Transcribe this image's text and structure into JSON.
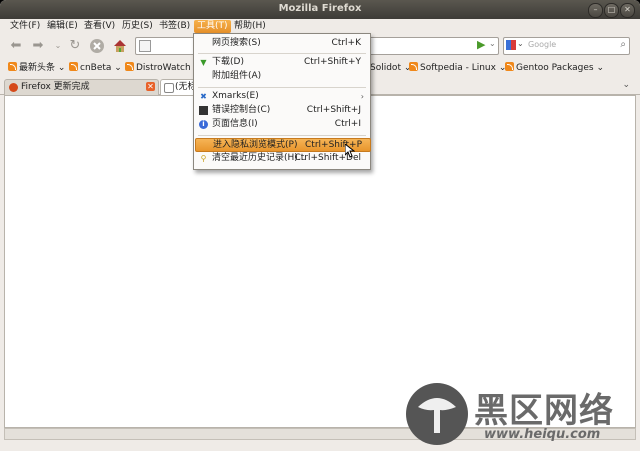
{
  "window": {
    "title": "Mozilla Firefox",
    "controls": [
      "–",
      "□",
      "✕"
    ]
  },
  "menubar": {
    "items": [
      "文件(F)",
      "编辑(E)",
      "查看(V)",
      "历史(S)",
      "书签(B)",
      "工具(T)",
      "帮助(H)"
    ],
    "open_index": 5
  },
  "search": {
    "placeholder": "Google"
  },
  "bookmarks": [
    "最新头条",
    "cnBeta",
    "DistroWatch",
    "Solidot",
    "Softpedia - Linux",
    "Gentoo Packages"
  ],
  "tabs": [
    {
      "label": "Firefox 更新完成",
      "active": false
    },
    {
      "label": "(无标",
      "active": true
    }
  ],
  "tools_menu": {
    "items": [
      {
        "label": "网页搜索(S)",
        "shortcut": "Ctrl+K",
        "icon": ""
      },
      {
        "label": "下载(D)",
        "shortcut": "Ctrl+Shift+Y",
        "icon": "download-icon"
      },
      {
        "label": "附加组件(A)",
        "shortcut": "",
        "icon": ""
      },
      {
        "label": "Xmarks(E)",
        "shortcut": "",
        "icon": "xmarks-icon",
        "submenu": true
      },
      {
        "label": "错误控制台(C)",
        "shortcut": "Ctrl+Shift+J",
        "icon": "console-icon"
      },
      {
        "label": "页面信息(I)",
        "shortcut": "Ctrl+I",
        "icon": "info-icon"
      },
      {
        "label": "进入隐私浏览模式(P)",
        "shortcut": "Ctrl+Shift+P",
        "icon": "",
        "highlighted": true
      },
      {
        "label": "清空最近历史记录(H)...",
        "shortcut": "Ctrl+Shift+Del",
        "icon": "broom-icon"
      }
    ]
  },
  "watermark": {
    "text": "黑区网络",
    "url": "www.heiqu.com"
  },
  "colors": {
    "accent": "#e8952c",
    "titlebar": "#3d3b37",
    "rss": "#f0881a"
  }
}
